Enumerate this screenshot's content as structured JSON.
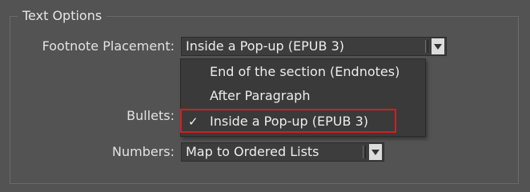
{
  "section": {
    "title": "Text Options"
  },
  "footnote": {
    "label": "Footnote Placement:",
    "selected": "Inside a Pop-up (EPUB 3)",
    "options": [
      "End of the section (Endnotes)",
      "After Paragraph",
      "Inside a Pop-up (EPUB 3)"
    ],
    "checked_index": 2,
    "check_glyph": "✓"
  },
  "bullets": {
    "label": "Bullets:"
  },
  "numbers": {
    "label": "Numbers:",
    "selected": "Map to Ordered Lists"
  },
  "icons": {
    "dropdown_arrow": "chevron-down-icon",
    "checkmark": "checkmark-icon"
  },
  "colors": {
    "panel_bg": "#535353",
    "field_bg": "#3d3d3d",
    "highlight_border": "#d21f1f"
  }
}
